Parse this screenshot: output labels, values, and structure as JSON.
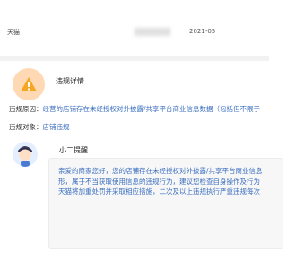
{
  "header": {
    "source": "天猫",
    "date": "2021-05"
  },
  "notice": {
    "title": "违规详情",
    "reason_label": "违规原因：",
    "reason_value": "经营的店铺存在未经授权对外披露/共享平台商业信息数据（包括但不限于",
    "object_label": "违规对象：",
    "object_value": "店铺违规"
  },
  "message": {
    "sender": "小二提醒",
    "lines": [
      "亲爱的商家您好，您的店铺存在未经授权对外披露/共享平台商业信息",
      "形，属于不当获取使用信息的违规行为，建议您检查自身操作及行为",
      "天猫将加重处罚并采取相应措施，二次及以上违规执行严重违规每次"
    ]
  },
  "colors": {
    "accent_blue": "#3a6ebf",
    "warning_orange": "#f5a623"
  }
}
